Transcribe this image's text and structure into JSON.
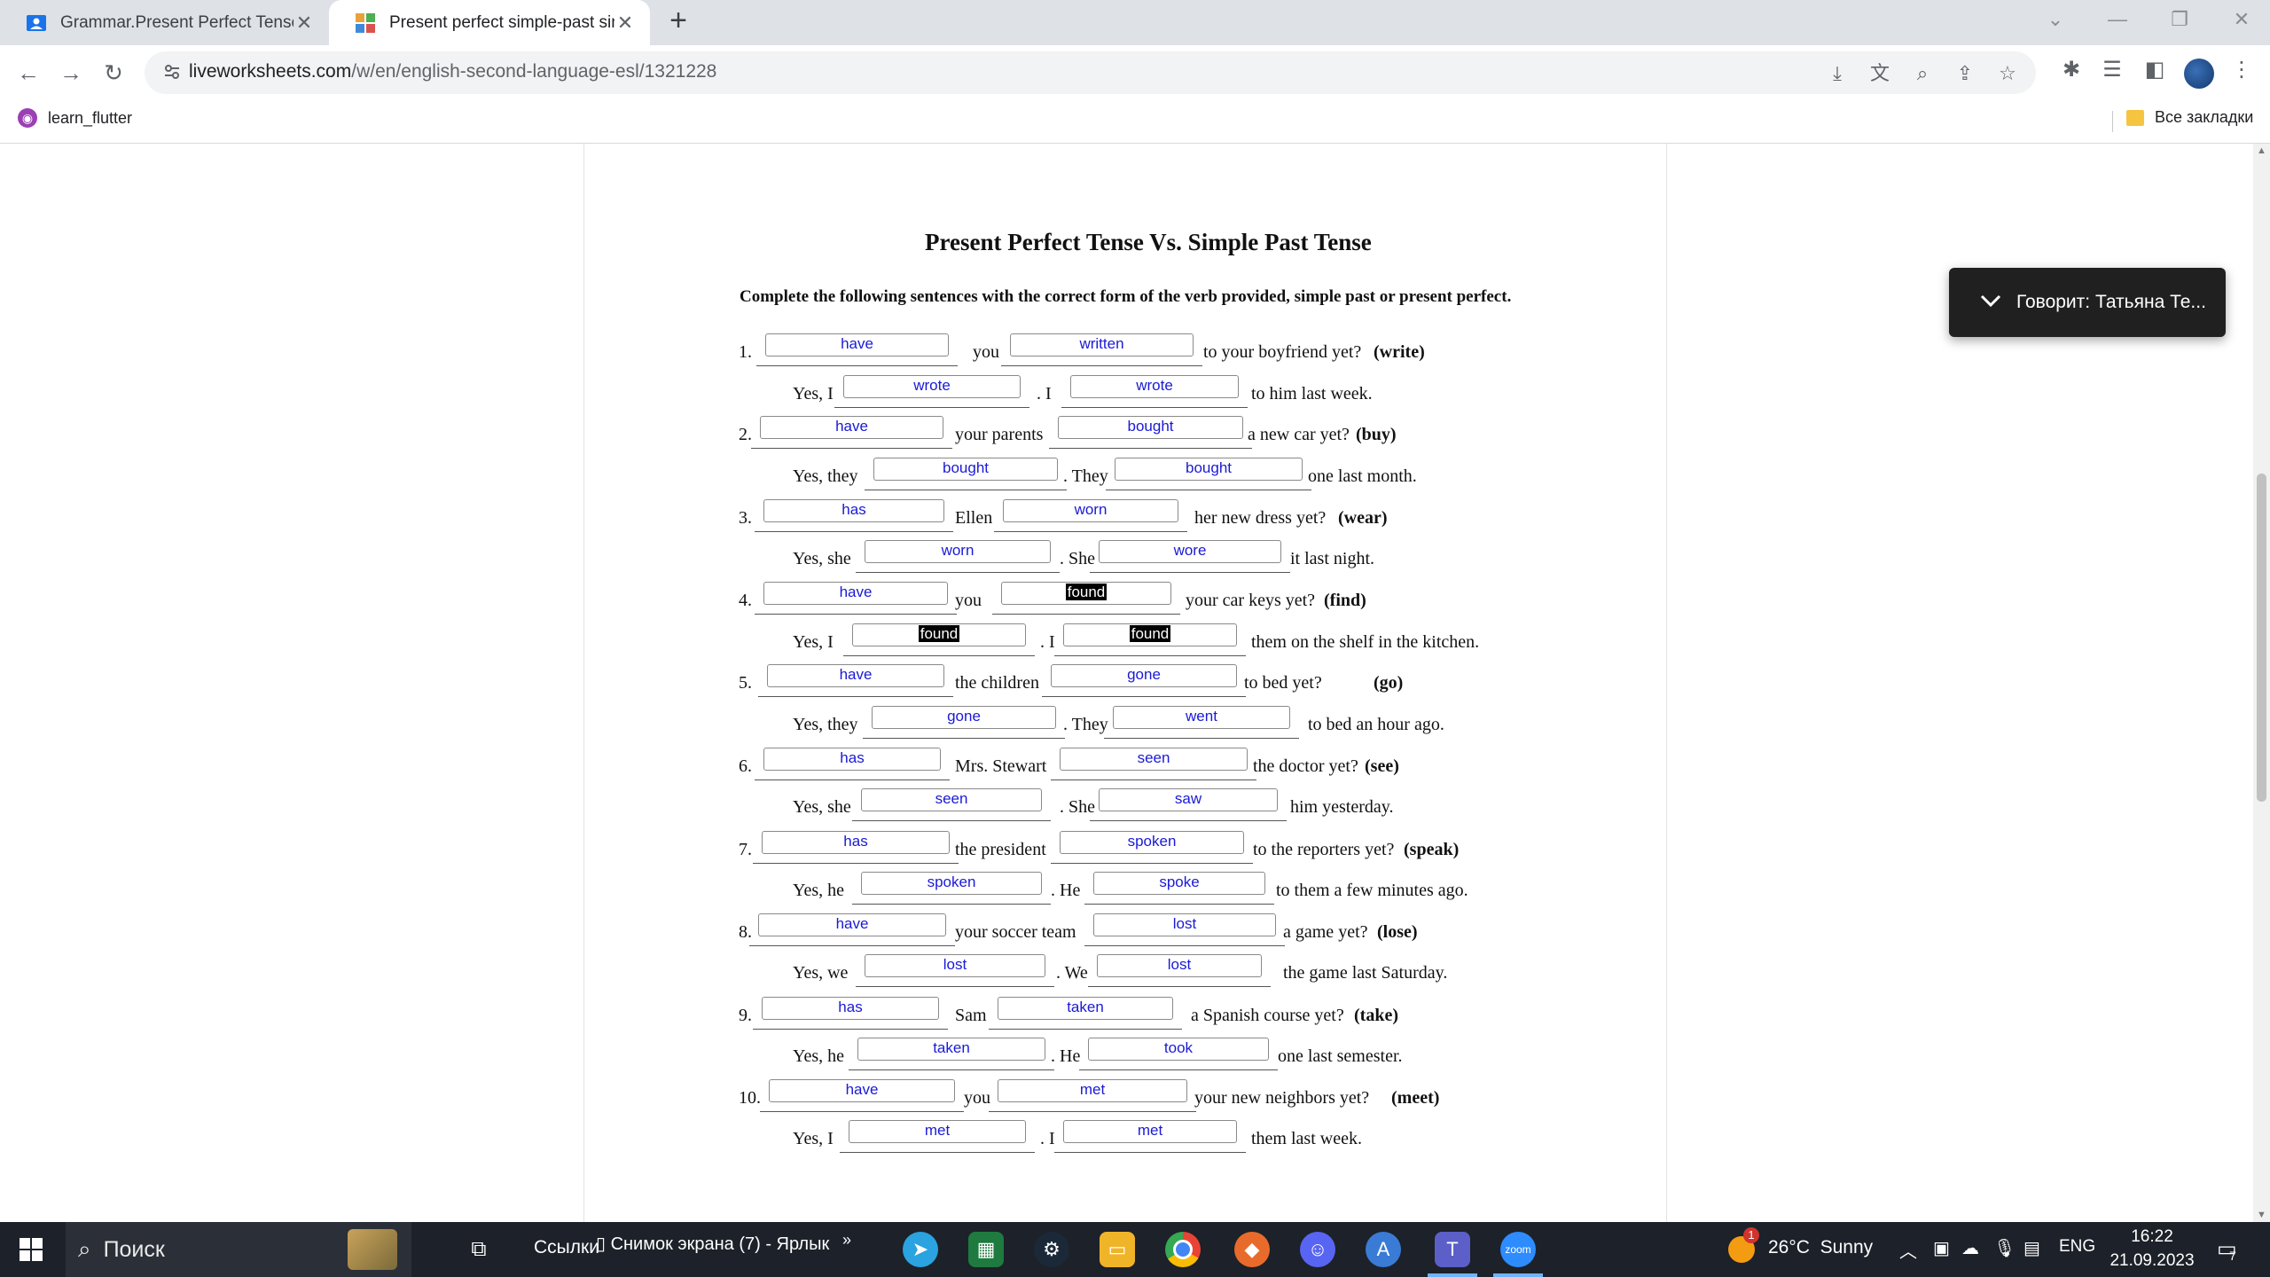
{
  "browser": {
    "tabs": [
      {
        "title": "Grammar.Present Perfect Tense",
        "active": false
      },
      {
        "title": "Present perfect simple-past simp",
        "active": true
      }
    ],
    "url_domain": "liveworksheets.com",
    "url_path": "/w/en/english-second-language-esl/1321228",
    "bookmark": "learn_flutter",
    "all_bookmarks": "Все закладки"
  },
  "worksheet": {
    "title": "Present Perfect Tense Vs. Simple Past Tense",
    "instructions": "Complete the following sentences with the correct form of the verb provided, simple past or present perfect.",
    "items": [
      {
        "num": "1.",
        "q_mid": "you",
        "q_end": "to your boyfriend yet?",
        "verb": "(write)",
        "a1": "have",
        "a2": "written",
        "ans_start": "Yes, I",
        "ans_mid": ". I",
        "ans_end": "to him last week.",
        "b1": "wrote",
        "b2": "wrote"
      },
      {
        "num": "2.",
        "q_mid": "your parents",
        "q_end": "a new car yet?",
        "verb": "(buy)",
        "a1": "have",
        "a2": "bought",
        "ans_start": "Yes, they",
        "ans_mid": ". They",
        "ans_end": "one last month.",
        "b1": "bought",
        "b2": "bought"
      },
      {
        "num": "3.",
        "q_mid": "Ellen",
        "q_end": "her new dress yet?",
        "verb": "(wear)",
        "a1": "has",
        "a2": "worn",
        "ans_start": "Yes, she",
        "ans_mid": ". She",
        "ans_end": "it last night.",
        "b1": "worn",
        "b2": "wore"
      },
      {
        "num": "4.",
        "q_mid": "you",
        "q_end": "your car keys yet?",
        "verb": "(find)",
        "a1": "have",
        "a2": "found",
        "ans_start": "Yes, I",
        "ans_mid": ". I",
        "ans_end": "them on the shelf in the kitchen.",
        "b1": "found",
        "b2": "found"
      },
      {
        "num": "5.",
        "q_mid": "the children",
        "q_end": "to bed yet?",
        "verb": "(go)",
        "a1": "have",
        "a2": "gone",
        "ans_start": "Yes, they",
        "ans_mid": ". They",
        "ans_end": "to bed an hour ago.",
        "b1": "gone",
        "b2": "went"
      },
      {
        "num": "6.",
        "q_mid": "Mrs. Stewart",
        "q_end": "the doctor yet?",
        "verb": "(see)",
        "a1": "has",
        "a2": "seen",
        "ans_start": "Yes, she",
        "ans_mid": ". She",
        "ans_end": "him yesterday.",
        "b1": "seen",
        "b2": "saw"
      },
      {
        "num": "7.",
        "q_mid": "the president",
        "q_end": "to the reporters yet?",
        "verb": "(speak)",
        "a1": "has",
        "a2": "spoken",
        "ans_start": "Yes, he",
        "ans_mid": ". He",
        "ans_end": "to them a few minutes ago.",
        "b1": "spoken",
        "b2": "spoke"
      },
      {
        "num": "8.",
        "q_mid": "your soccer team",
        "q_end": "a game yet?",
        "verb": "(lose)",
        "a1": "have",
        "a2": "lost",
        "ans_start": "Yes, we",
        "ans_mid": ". We",
        "ans_end": "the game last Saturday.",
        "b1": "lost",
        "b2": "lost"
      },
      {
        "num": "9.",
        "q_mid": "Sam",
        "q_end": "a Spanish course yet?",
        "verb": "(take)",
        "a1": "has",
        "a2": "taken",
        "ans_start": "Yes, he",
        "ans_mid": ". He",
        "ans_end": "one last semester.",
        "b1": "taken",
        "b2": "took"
      },
      {
        "num": "10.",
        "q_mid": "you",
        "q_end": "your new neighbors yet?",
        "verb": "(meet)",
        "a1": "have",
        "a2": "met",
        "ans_start": "Yes, I",
        "ans_mid": ". I",
        "ans_end": "them last week.",
        "b1": "met",
        "b2": "met"
      }
    ]
  },
  "toast": {
    "text": "Говорит: Татьяна Те..."
  },
  "taskbar": {
    "search": "Поиск",
    "links": "Ссылки",
    "shortcut": "Снимок экрана (7) - Ярлык",
    "weather_temp": "26°C",
    "weather_desc": "Sunny",
    "weather_badge": "1",
    "lang": "ENG",
    "time": "16:22",
    "date": "21.09.2023",
    "notifications": "7"
  }
}
